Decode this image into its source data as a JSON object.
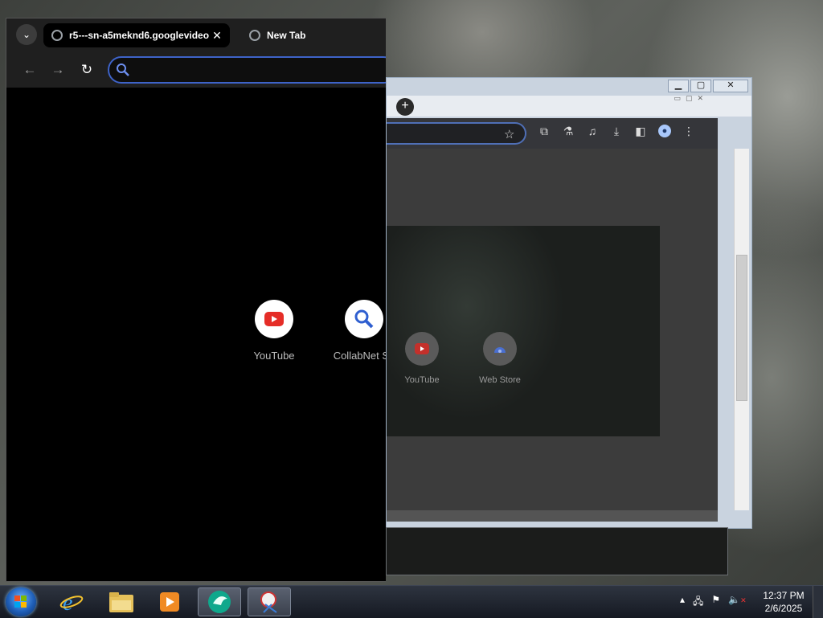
{
  "front_window": {
    "tabs": [
      {
        "title": "r5---sn-a5meknd6.googlevideo",
        "close": "✕"
      },
      {
        "title": "New Tab"
      }
    ],
    "omnibox": {
      "value": "",
      "placeholder": ""
    },
    "shortcuts": [
      {
        "label": "YouTube",
        "icon": "youtube-icon"
      },
      {
        "label": "CollabNet Se",
        "icon": "search-icon"
      }
    ]
  },
  "back_window": {
    "shortcuts": [
      {
        "label": "YouTube",
        "icon": "youtube-icon"
      },
      {
        "label": "Web Store",
        "icon": "webstore-icon"
      }
    ]
  },
  "taskbar": {
    "clock_time": "12:37 PM",
    "clock_date": "2/6/2025",
    "apps": [
      "internet-explorer",
      "file-explorer",
      "media-player",
      "browser",
      "snipping-tool"
    ]
  },
  "colors": {
    "accent_blue": "#3e63c8",
    "youtube_red": "#e52d27",
    "tab_strip": "#1f1f1f"
  }
}
